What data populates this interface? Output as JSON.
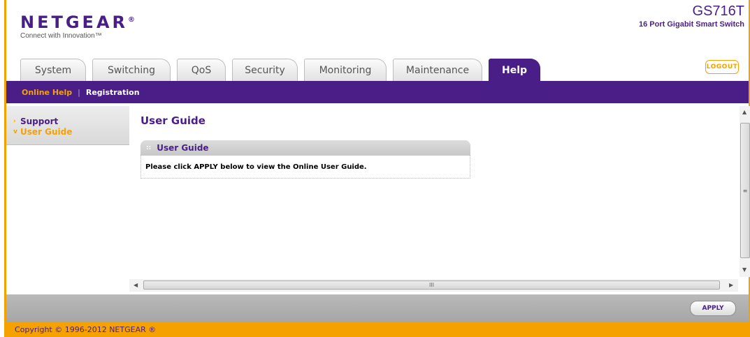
{
  "brand": {
    "logo": "NETGEAR",
    "logo_mark": "®",
    "tagline": "Connect with Innovation™"
  },
  "device": {
    "model": "GS716T",
    "description": "16 Port Gigabit Smart Switch"
  },
  "tabs": [
    {
      "label": "System",
      "active": false
    },
    {
      "label": "Switching",
      "active": false
    },
    {
      "label": "QoS",
      "active": false
    },
    {
      "label": "Security",
      "active": false
    },
    {
      "label": "Monitoring",
      "active": false
    },
    {
      "label": "Maintenance",
      "active": false
    },
    {
      "label": "Help",
      "active": true
    }
  ],
  "logout_label": "LOGOUT",
  "subnav": {
    "items": [
      {
        "label": "Online Help",
        "active": true
      },
      {
        "label": "Registration",
        "active": false
      }
    ],
    "separator": "|"
  },
  "leftnav": {
    "items": [
      {
        "label": "Support",
        "arrow": "›",
        "active": false
      },
      {
        "label": "User Guide",
        "arrow": "v",
        "active": true
      }
    ]
  },
  "main": {
    "title": "User Guide",
    "panel": {
      "title": "User Guide",
      "message": "Please click APPLY below to view the Online User Guide."
    }
  },
  "scrollbars": {
    "thumb_grip_v": "≡",
    "thumb_grip_h": "III",
    "arrow_up": "▲",
    "arrow_down": "▼",
    "arrow_left": "◀",
    "arrow_right": "▶"
  },
  "actions": {
    "apply_label": "APPLY"
  },
  "footer": {
    "copyright": "Copyright © 1996-2012 NETGEAR ®"
  },
  "colors": {
    "brand_purple": "#4a1e87",
    "brand_orange": "#f5a100",
    "action_bar_gray": "#b0b0b0"
  }
}
